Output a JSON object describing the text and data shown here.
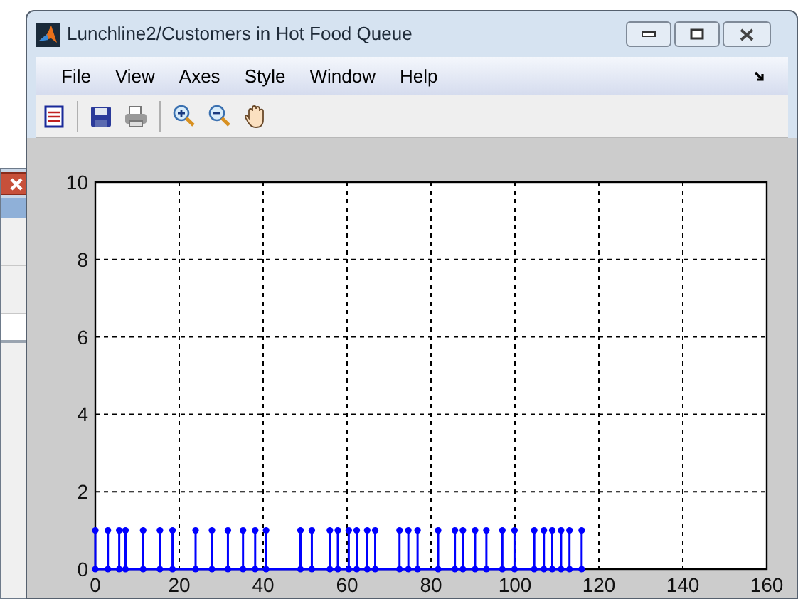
{
  "window": {
    "title": "Lunchline2/Customers in Hot Food Queue"
  },
  "menu": [
    "File",
    "View",
    "Axes",
    "Style",
    "Window",
    "Help"
  ],
  "figure": {
    "chart_data": {
      "type": "scatter",
      "x": [
        0,
        3,
        5.7,
        7.2,
        11.4,
        15.4,
        18.4,
        23.9,
        27.8,
        31.6,
        35.2,
        38.1,
        40.7,
        48.9,
        51.6,
        55.9,
        57.8,
        60.4,
        62.3,
        64.8,
        66.7,
        72.5,
        74.6,
        76.8,
        81.7,
        85.7,
        87.6,
        90.5,
        93.2,
        97,
        99.9,
        104.6,
        106.9,
        108.9,
        111,
        113,
        115.9
      ],
      "series": [
        {
          "color": "#0000ff",
          "values": [
            1,
            1,
            1,
            1,
            1,
            1,
            1,
            1,
            1,
            1,
            1,
            1,
            1,
            1,
            1,
            1,
            1,
            1,
            1,
            1,
            1,
            1,
            1,
            1,
            1,
            1,
            1,
            1,
            1,
            1,
            1,
            1,
            1,
            1,
            1,
            1,
            1
          ]
        }
      ],
      "xlim": [
        0,
        160
      ],
      "ylim": [
        0,
        10
      ],
      "xticks": [
        0,
        20,
        40,
        60,
        80,
        100,
        120,
        140,
        160
      ],
      "yticks": [
        0,
        2,
        4,
        6,
        8,
        10
      ],
      "grid": true
    }
  }
}
